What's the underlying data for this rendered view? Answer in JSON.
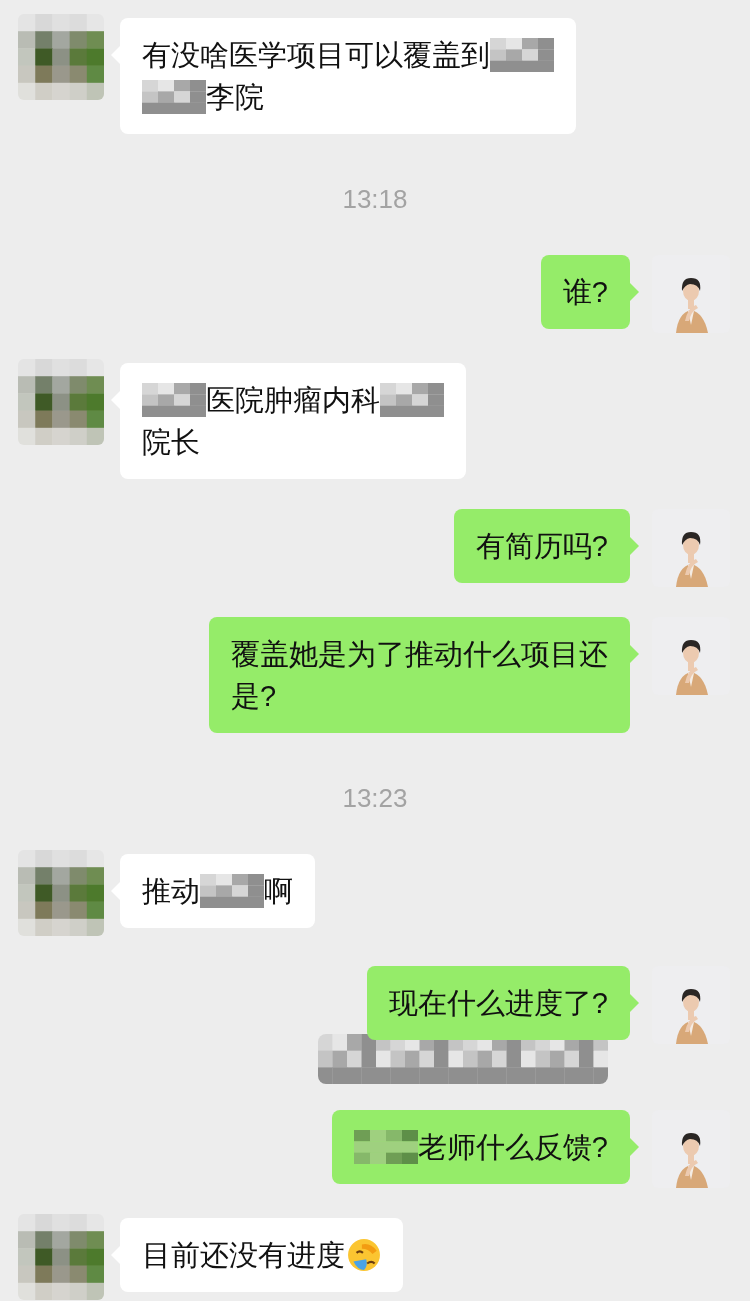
{
  "messages": [
    {
      "kind": "received",
      "lines": [
        [
          {
            "kind": "text",
            "text": "有没啥医学项目可以覆盖到"
          },
          {
            "kind": "mosaic"
          }
        ],
        [
          {
            "kind": "mosaic"
          },
          {
            "kind": "text",
            "text": "李院"
          }
        ]
      ]
    },
    {
      "kind": "time",
      "text": "13:18"
    },
    {
      "kind": "sent",
      "lines": [
        [
          {
            "kind": "text",
            "text": "谁?"
          }
        ]
      ]
    },
    {
      "kind": "received",
      "lines": [
        [
          {
            "kind": "mosaic"
          },
          {
            "kind": "text",
            "text": "医院肿瘤内科"
          },
          {
            "kind": "mosaic"
          }
        ],
        [
          {
            "kind": "text",
            "text": "院长"
          }
        ]
      ]
    },
    {
      "kind": "sent",
      "lines": [
        [
          {
            "kind": "text",
            "text": "有简历吗?"
          }
        ]
      ]
    },
    {
      "kind": "sent",
      "lines": [
        [
          {
            "kind": "text",
            "text": "覆盖她是为了推动什么项目还"
          }
        ],
        [
          {
            "kind": "text",
            "text": "是?"
          }
        ]
      ]
    },
    {
      "kind": "time",
      "text": "13:23"
    },
    {
      "kind": "received",
      "lines": [
        [
          {
            "kind": "text",
            "text": "推动"
          },
          {
            "kind": "mosaic"
          },
          {
            "kind": "text",
            "text": "啊"
          }
        ]
      ]
    },
    {
      "kind": "sent",
      "lines": [
        [
          {
            "kind": "text",
            "text": "现在什么进度了?"
          }
        ]
      ]
    },
    {
      "kind": "redacted"
    },
    {
      "kind": "sent",
      "lines": [
        [
          {
            "kind": "mosaic"
          },
          {
            "kind": "text",
            "text": "老师什么反馈?"
          }
        ]
      ]
    },
    {
      "kind": "received",
      "lines": [
        [
          {
            "kind": "text",
            "text": "目前还没有进度"
          },
          {
            "kind": "emoji"
          }
        ]
      ]
    }
  ]
}
